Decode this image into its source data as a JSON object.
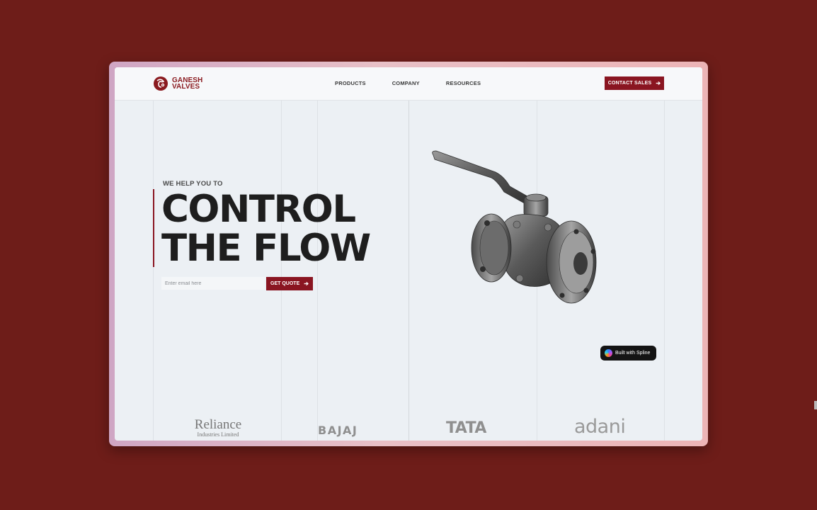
{
  "brand": {
    "line1": "GANESH",
    "line2": "VALVES",
    "color": "#8a1a1f"
  },
  "nav": {
    "items": [
      {
        "label": "PRODUCTS"
      },
      {
        "label": "COMPANY"
      },
      {
        "label": "RESOURCES"
      }
    ],
    "cta_label": "CONTACT SALES",
    "cta_icon": "arrow-right-icon"
  },
  "hero": {
    "eyebrow": "WE HELP YOU TO",
    "headline_line1": "CONTROL",
    "headline_line2": "THE FLOW",
    "email_placeholder": "Enter email here",
    "quote_label": "GET QUOTE",
    "accent_color": "#8a1521"
  },
  "spline_badge": {
    "label": "Built with Spline"
  },
  "clients": {
    "reliance_line1": "Reliance",
    "reliance_line2": "Industries Limited",
    "bajaj": "BAJAJ",
    "tata": "TATA",
    "adani": "adani"
  },
  "colors": {
    "page_background": "#6e1d19",
    "window_background": "#ecf0f4"
  }
}
